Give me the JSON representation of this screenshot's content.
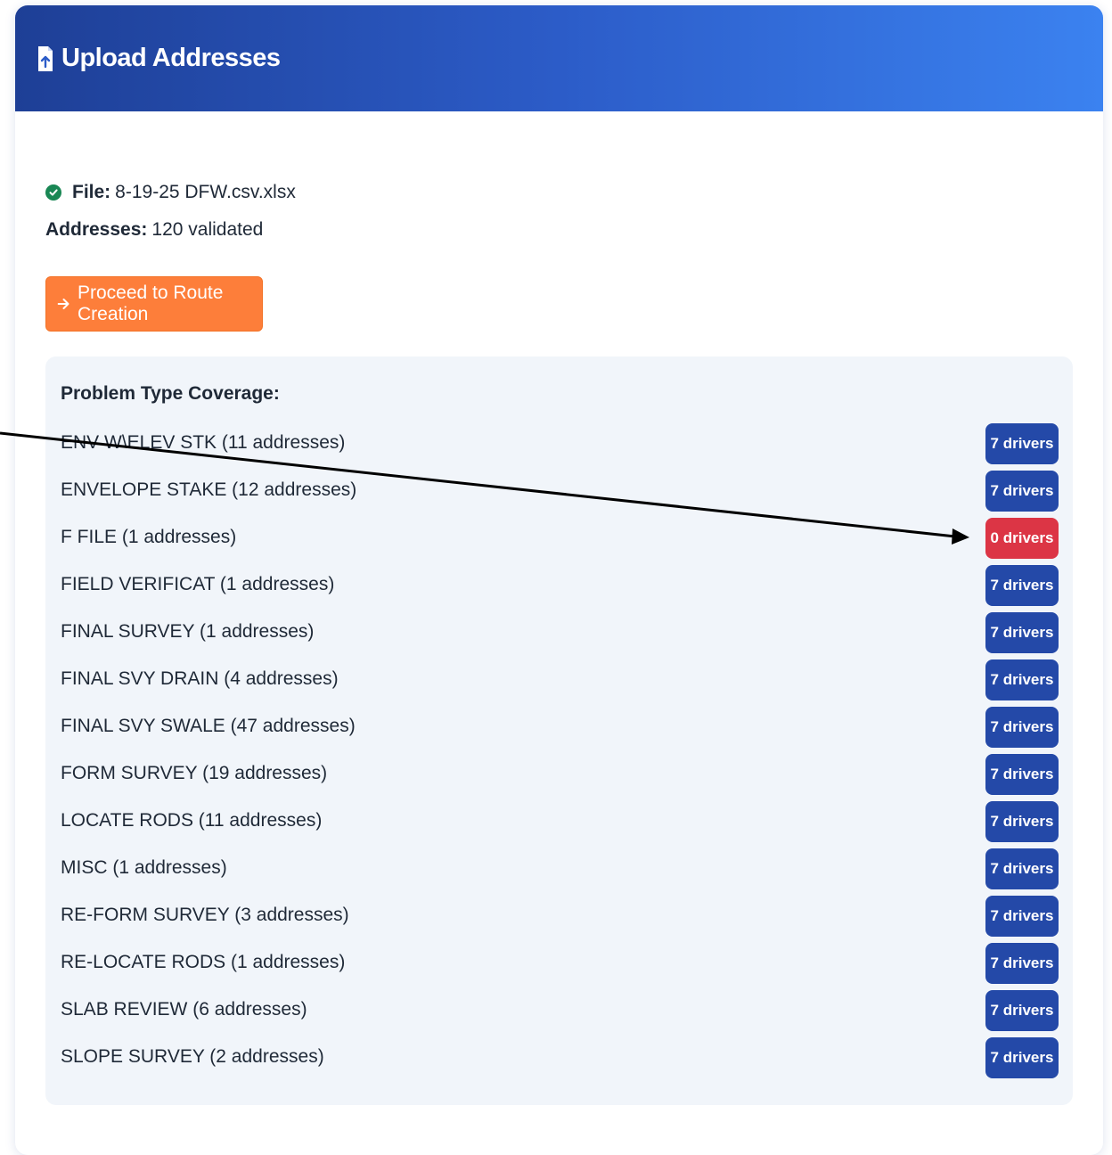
{
  "header": {
    "title": "Upload Addresses",
    "icon": "file-upload-icon"
  },
  "upload": {
    "file_label": "File:",
    "file_name": "8-19-25 DFW.csv.xlsx",
    "addresses_label": "Addresses:",
    "addresses_value": "120 validated",
    "status_icon": "check-circle-icon",
    "status_color": "#198754"
  },
  "proceed_button": {
    "label": "Proceed to Route Creation",
    "icon": "arrow-right-icon",
    "color": "#fd7e3a"
  },
  "coverage": {
    "title": "Problem Type Coverage:",
    "items": [
      {
        "label": "ENV W\\ELEV STK (11 addresses)",
        "badge": "7 drivers",
        "status": "ok"
      },
      {
        "label": "ENVELOPE STAKE (12 addresses)",
        "badge": "7 drivers",
        "status": "ok"
      },
      {
        "label": "F FILE (1 addresses)",
        "badge": "0 drivers",
        "status": "zero"
      },
      {
        "label": "FIELD VERIFICAT (1 addresses)",
        "badge": "7 drivers",
        "status": "ok"
      },
      {
        "label": "FINAL SURVEY (1 addresses)",
        "badge": "7 drivers",
        "status": "ok"
      },
      {
        "label": "FINAL SVY DRAIN (4 addresses)",
        "badge": "7 drivers",
        "status": "ok"
      },
      {
        "label": "FINAL SVY SWALE (47 addresses)",
        "badge": "7 drivers",
        "status": "ok"
      },
      {
        "label": "FORM SURVEY (19 addresses)",
        "badge": "7 drivers",
        "status": "ok"
      },
      {
        "label": "LOCATE RODS (11 addresses)",
        "badge": "7 drivers",
        "status": "ok"
      },
      {
        "label": "MISC (1 addresses)",
        "badge": "7 drivers",
        "status": "ok"
      },
      {
        "label": "RE-FORM SURVEY (3 addresses)",
        "badge": "7 drivers",
        "status": "ok"
      },
      {
        "label": "RE-LOCATE RODS (1 addresses)",
        "badge": "7 drivers",
        "status": "ok"
      },
      {
        "label": "SLAB REVIEW (6 addresses)",
        "badge": "7 drivers",
        "status": "ok"
      },
      {
        "label": "SLOPE SURVEY (2 addresses)",
        "badge": "7 drivers",
        "status": "ok"
      }
    ]
  },
  "colors": {
    "header_gradient_start": "#1e3f96",
    "header_gradient_end": "#3b82f0",
    "badge_ok": "#2449a8",
    "badge_zero": "#dc3545",
    "annotation_arrow": "#000000"
  }
}
